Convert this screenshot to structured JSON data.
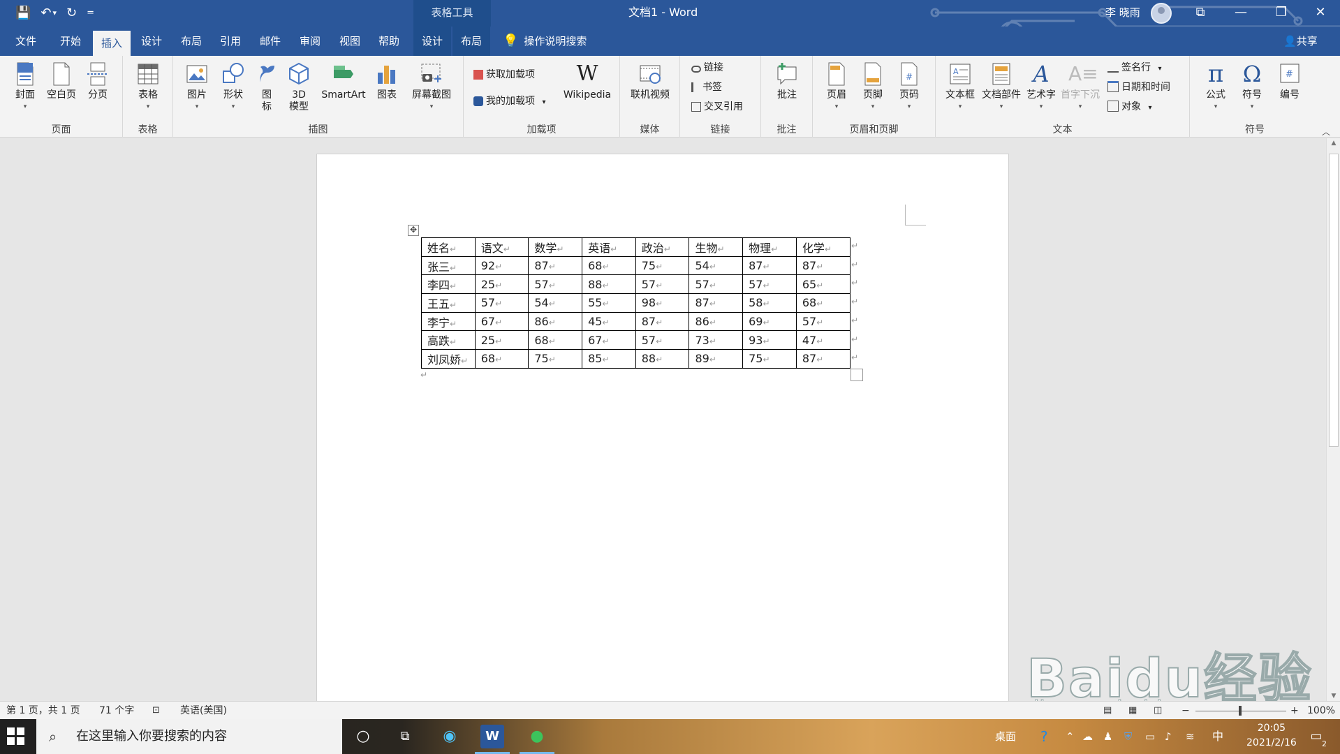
{
  "titlebar": {
    "context_group": "表格工具",
    "doc_title": "文档1  -  Word",
    "user_name": "李 晓雨",
    "qat": {
      "save_icon": "💾",
      "undo_icon": "↶",
      "undo_dd": "▾",
      "redo_icon": "↻",
      "customize": "="
    },
    "win": {
      "ribbon_display": "⧉",
      "minimize": "—",
      "restore": "❐",
      "close": "✕"
    }
  },
  "tabs": [
    "文件",
    "开始",
    "插入",
    "设计",
    "布局",
    "引用",
    "邮件",
    "审阅",
    "视图",
    "帮助",
    "设计",
    "布局"
  ],
  "active_tab": "插入",
  "tellme": "操作说明搜索",
  "share": "共享",
  "ribbon": {
    "pages": {
      "label": "页面",
      "cover": "封面",
      "blank": "空白页",
      "break": "分页"
    },
    "tables": {
      "label": "表格",
      "table": "表格"
    },
    "illustrations": {
      "label": "插图",
      "picture": "图片",
      "shapes": "形状",
      "icons": "图\n标",
      "model3d": "3D\n模型",
      "smartart": "SmartArt",
      "chart": "图表",
      "screenshot": "屏幕截图"
    },
    "addins": {
      "label": "加载项",
      "get": "获取加载项",
      "mine": "我的加载项",
      "wikipedia": "Wikipedia"
    },
    "media": {
      "label": "媒体",
      "video": "联机视频"
    },
    "links": {
      "label": "链接",
      "link": "链接",
      "bookmark": "书签",
      "xref": "交叉引用"
    },
    "comments": {
      "label": "批注",
      "comment": "批注"
    },
    "header_footer": {
      "label": "页眉和页脚",
      "header": "页眉",
      "footer": "页脚",
      "page_number": "页码"
    },
    "text": {
      "label": "文本",
      "textbox": "文本框",
      "quickparts": "文档部件",
      "wordart": "艺术字",
      "dropcap": "首字下沉",
      "signature": "签名行",
      "datetime": "日期和时间",
      "object": "对象"
    },
    "symbols": {
      "label": "符号",
      "equation": "公式",
      "symbol": "符号",
      "number": "编号"
    },
    "dropdown_mark": "▾"
  },
  "table": {
    "headers": [
      "姓名",
      "语文",
      "数学",
      "英语",
      "政治",
      "生物",
      "物理",
      "化学"
    ],
    "rows": [
      [
        "张三",
        "92",
        "87",
        "68",
        "75",
        "54",
        "87",
        "87"
      ],
      [
        "李四",
        "25",
        "57",
        "88",
        "57",
        "57",
        "57",
        "65"
      ],
      [
        "王五",
        "57",
        "54",
        "55",
        "98",
        "87",
        "58",
        "68"
      ],
      [
        "李宁",
        "67",
        "86",
        "45",
        "87",
        "86",
        "69",
        "57"
      ],
      [
        "高跌",
        "25",
        "68",
        "67",
        "57",
        "73",
        "93",
        "47"
      ],
      [
        "刘凤娇",
        "68",
        "75",
        "85",
        "88",
        "89",
        "75",
        "87"
      ]
    ],
    "cell_mark": "↵",
    "move_handle": "✥"
  },
  "statusbar": {
    "page": "第 1 页，共 1 页",
    "words": "71 个字",
    "language": "英语(美国)",
    "zoom": "100%",
    "zoom_minus": "−",
    "zoom_plus": "+"
  },
  "taskbar": {
    "search_placeholder": "在这里输入你要搜索的内容",
    "desktop_label": "桌面",
    "ime": "中",
    "time": "20:05",
    "date": "2021/2/16",
    "notification_count": "2"
  },
  "watermark": {
    "brand": "Baidu经验",
    "url": "jingyan.baidu.com"
  },
  "colors": {
    "word_blue": "#2b579a",
    "ribbon_bg": "#f3f3f3",
    "canvas_bg": "#e6e6e6",
    "accent_tab_underline": "#76b9ed"
  }
}
